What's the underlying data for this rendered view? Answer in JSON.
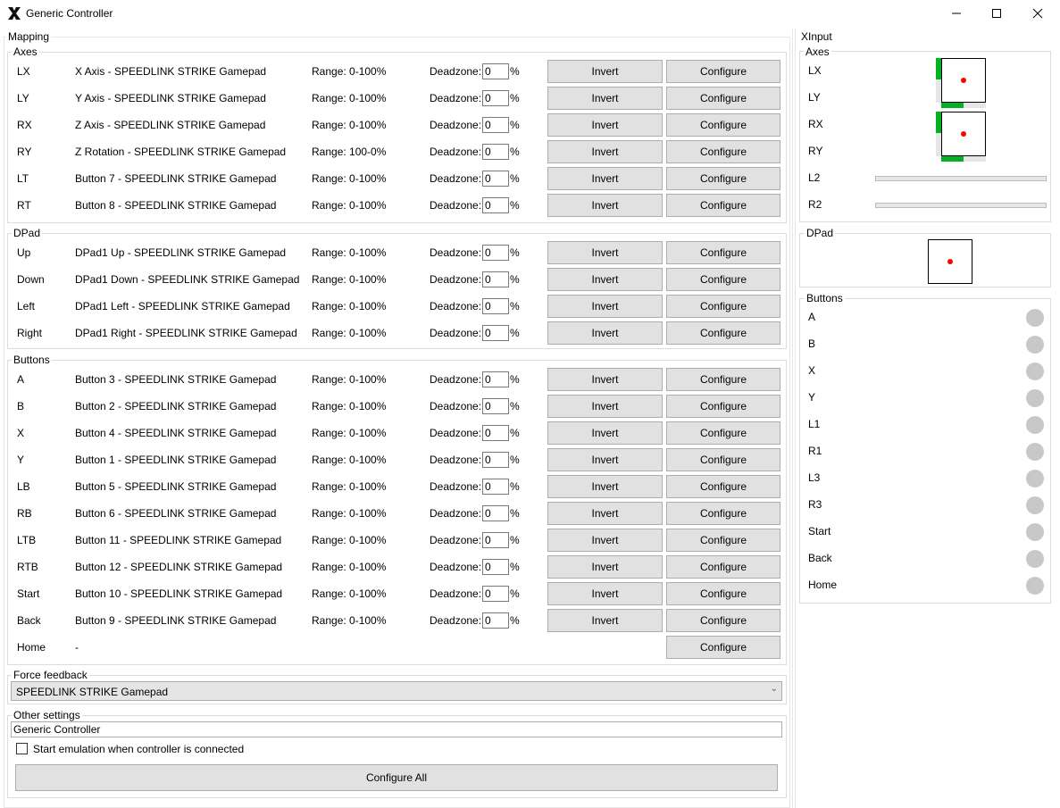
{
  "window": {
    "title": "Generic Controller",
    "minimize": "—",
    "maximize": "☐",
    "close": "✕"
  },
  "mapping": {
    "label": "Mapping",
    "deadzone_label": "Deadzone:",
    "percent": "%",
    "invert_label": "Invert",
    "configure_label": "Configure",
    "axes": {
      "label": "Axes",
      "rows": [
        {
          "name": "LX",
          "map": "X Axis - SPEEDLINK STRIKE Gamepad",
          "range": "Range: 0-100%",
          "deadzone": "0"
        },
        {
          "name": "LY",
          "map": "Y Axis - SPEEDLINK STRIKE Gamepad",
          "range": "Range: 0-100%",
          "deadzone": "0"
        },
        {
          "name": "RX",
          "map": "Z Axis - SPEEDLINK STRIKE Gamepad",
          "range": "Range: 0-100%",
          "deadzone": "0"
        },
        {
          "name": "RY",
          "map": "Z Rotation - SPEEDLINK STRIKE Gamepad",
          "range": "Range: 100-0%",
          "deadzone": "0"
        },
        {
          "name": "LT",
          "map": "Button 7 - SPEEDLINK STRIKE Gamepad",
          "range": "Range: 0-100%",
          "deadzone": "0"
        },
        {
          "name": "RT",
          "map": "Button 8 - SPEEDLINK STRIKE Gamepad",
          "range": "Range: 0-100%",
          "deadzone": "0"
        }
      ]
    },
    "dpad": {
      "label": "DPad",
      "rows": [
        {
          "name": "Up",
          "map": "DPad1 Up - SPEEDLINK STRIKE Gamepad",
          "range": "Range: 0-100%",
          "deadzone": "0"
        },
        {
          "name": "Down",
          "map": "DPad1 Down - SPEEDLINK STRIKE Gamepad",
          "range": "Range: 0-100%",
          "deadzone": "0"
        },
        {
          "name": "Left",
          "map": "DPad1 Left - SPEEDLINK STRIKE Gamepad",
          "range": "Range: 0-100%",
          "deadzone": "0"
        },
        {
          "name": "Right",
          "map": "DPad1 Right - SPEEDLINK STRIKE Gamepad",
          "range": "Range: 0-100%",
          "deadzone": "0"
        }
      ]
    },
    "buttons": {
      "label": "Buttons",
      "rows": [
        {
          "name": "A",
          "map": "Button 3 - SPEEDLINK STRIKE Gamepad",
          "range": "Range: 0-100%",
          "deadzone": "0"
        },
        {
          "name": "B",
          "map": "Button 2 - SPEEDLINK STRIKE Gamepad",
          "range": "Range: 0-100%",
          "deadzone": "0"
        },
        {
          "name": "X",
          "map": "Button 4 - SPEEDLINK STRIKE Gamepad",
          "range": "Range: 0-100%",
          "deadzone": "0"
        },
        {
          "name": "Y",
          "map": "Button 1 - SPEEDLINK STRIKE Gamepad",
          "range": "Range: 0-100%",
          "deadzone": "0"
        },
        {
          "name": "LB",
          "map": "Button 5 - SPEEDLINK STRIKE Gamepad",
          "range": "Range: 0-100%",
          "deadzone": "0"
        },
        {
          "name": "RB",
          "map": "Button 6 - SPEEDLINK STRIKE Gamepad",
          "range": "Range: 0-100%",
          "deadzone": "0"
        },
        {
          "name": "LTB",
          "map": "Button 11 - SPEEDLINK STRIKE Gamepad",
          "range": "Range: 0-100%",
          "deadzone": "0"
        },
        {
          "name": "RTB",
          "map": "Button 12 - SPEEDLINK STRIKE Gamepad",
          "range": "Range: 0-100%",
          "deadzone": "0"
        },
        {
          "name": "Start",
          "map": "Button 10 - SPEEDLINK STRIKE Gamepad",
          "range": "Range: 0-100%",
          "deadzone": "0"
        },
        {
          "name": "Back",
          "map": "Button 9 - SPEEDLINK STRIKE Gamepad",
          "range": "Range: 0-100%",
          "deadzone": "0"
        }
      ],
      "home": {
        "name": "Home",
        "map": "-"
      }
    }
  },
  "force_feedback": {
    "label": "Force feedback",
    "selected": "SPEEDLINK STRIKE Gamepad",
    "chevron": "⌄"
  },
  "other_settings": {
    "label": "Other settings",
    "name_value": "Generic Controller",
    "start_emulation_label": "Start emulation when controller is connected",
    "start_emulation_checked": false,
    "configure_all_label": "Configure All"
  },
  "xinput": {
    "label": "XInput",
    "axes_label": "Axes",
    "axes": [
      "LX",
      "LY",
      "RX",
      "RY",
      "L2",
      "R2"
    ],
    "dpad_label": "DPad",
    "buttons_label": "Buttons",
    "buttons": [
      "A",
      "B",
      "X",
      "Y",
      "L1",
      "R1",
      "L3",
      "R3",
      "Start",
      "Back",
      "Home"
    ]
  },
  "colors": {
    "indicator_fill": "#06b025",
    "stick_dot": "#ff0000",
    "button_led": "#c8c8c8"
  }
}
